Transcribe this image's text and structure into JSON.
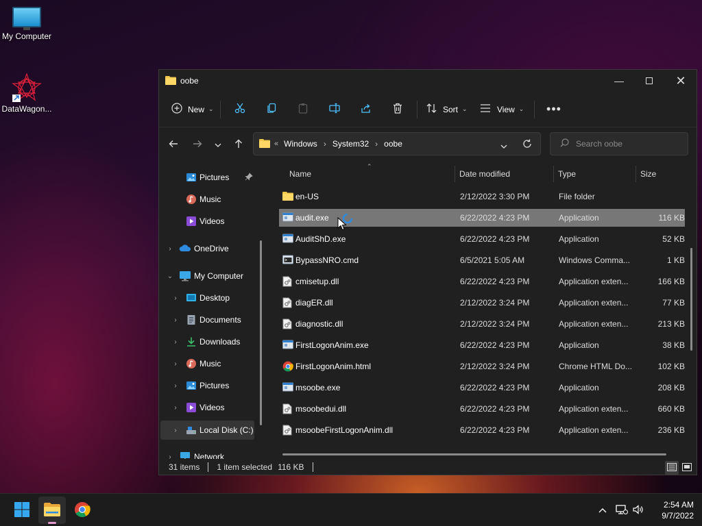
{
  "desktop": {
    "icons": [
      {
        "label": "My Computer"
      },
      {
        "label": "DataWagon..."
      }
    ]
  },
  "window": {
    "title": "oobe",
    "toolbar": {
      "new_label": "New",
      "sort_label": "Sort",
      "view_label": "View"
    },
    "address": {
      "crumbs": [
        "Windows",
        "System32",
        "oobe"
      ]
    },
    "search": {
      "placeholder": "Search oobe"
    },
    "nav": [
      {
        "label": "Pictures",
        "pinned": true
      },
      {
        "label": "Music"
      },
      {
        "label": "Videos"
      },
      {
        "label": "OneDrive"
      },
      {
        "label": "My Computer"
      },
      {
        "label": "Desktop"
      },
      {
        "label": "Documents"
      },
      {
        "label": "Downloads"
      },
      {
        "label": "Music"
      },
      {
        "label": "Pictures"
      },
      {
        "label": "Videos"
      },
      {
        "label": "Local Disk (C:)"
      },
      {
        "label": "Network"
      }
    ],
    "columns": {
      "name": "Name",
      "date": "Date modified",
      "type": "Type",
      "size": "Size"
    },
    "files": [
      {
        "name": "en-US",
        "date": "2/12/2022 3:30 PM",
        "type": "File folder",
        "size": "",
        "icon": "folder"
      },
      {
        "name": "audit.exe",
        "date": "6/22/2022 4:23 PM",
        "type": "Application",
        "size": "116 KB",
        "icon": "exe"
      },
      {
        "name": "AuditShD.exe",
        "date": "6/22/2022 4:23 PM",
        "type": "Application",
        "size": "52 KB",
        "icon": "exe"
      },
      {
        "name": "BypassNRO.cmd",
        "date": "6/5/2021 5:05 AM",
        "type": "Windows Comma...",
        "size": "1 KB",
        "icon": "cmd"
      },
      {
        "name": "cmisetup.dll",
        "date": "6/22/2022 4:23 PM",
        "type": "Application exten...",
        "size": "166 KB",
        "icon": "dll"
      },
      {
        "name": "diagER.dll",
        "date": "2/12/2022 3:24 PM",
        "type": "Application exten...",
        "size": "77 KB",
        "icon": "dll"
      },
      {
        "name": "diagnostic.dll",
        "date": "2/12/2022 3:24 PM",
        "type": "Application exten...",
        "size": "213 KB",
        "icon": "dll"
      },
      {
        "name": "FirstLogonAnim.exe",
        "date": "6/22/2022 4:23 PM",
        "type": "Application",
        "size": "38 KB",
        "icon": "exe"
      },
      {
        "name": "FirstLogonAnim.html",
        "date": "2/12/2022 3:24 PM",
        "type": "Chrome HTML Do...",
        "size": "102 KB",
        "icon": "chrome"
      },
      {
        "name": "msoobe.exe",
        "date": "6/22/2022 4:23 PM",
        "type": "Application",
        "size": "208 KB",
        "icon": "exe"
      },
      {
        "name": "msoobedui.dll",
        "date": "6/22/2022 4:23 PM",
        "type": "Application exten...",
        "size": "660 KB",
        "icon": "dll"
      },
      {
        "name": "msoobeFirstLogonAnim.dll",
        "date": "6/22/2022 4:23 PM",
        "type": "Application exten...",
        "size": "236 KB",
        "icon": "dll"
      }
    ],
    "status": {
      "count": "31 items",
      "selection": "1 item selected",
      "size": "116 KB"
    }
  },
  "taskbar": {
    "time": "2:54 AM",
    "date": "9/7/2022"
  },
  "colors": {
    "window_bg": "#202020",
    "selected_row": "#777777",
    "folder": "#f2c94c",
    "accent": "#4cc2ff"
  }
}
